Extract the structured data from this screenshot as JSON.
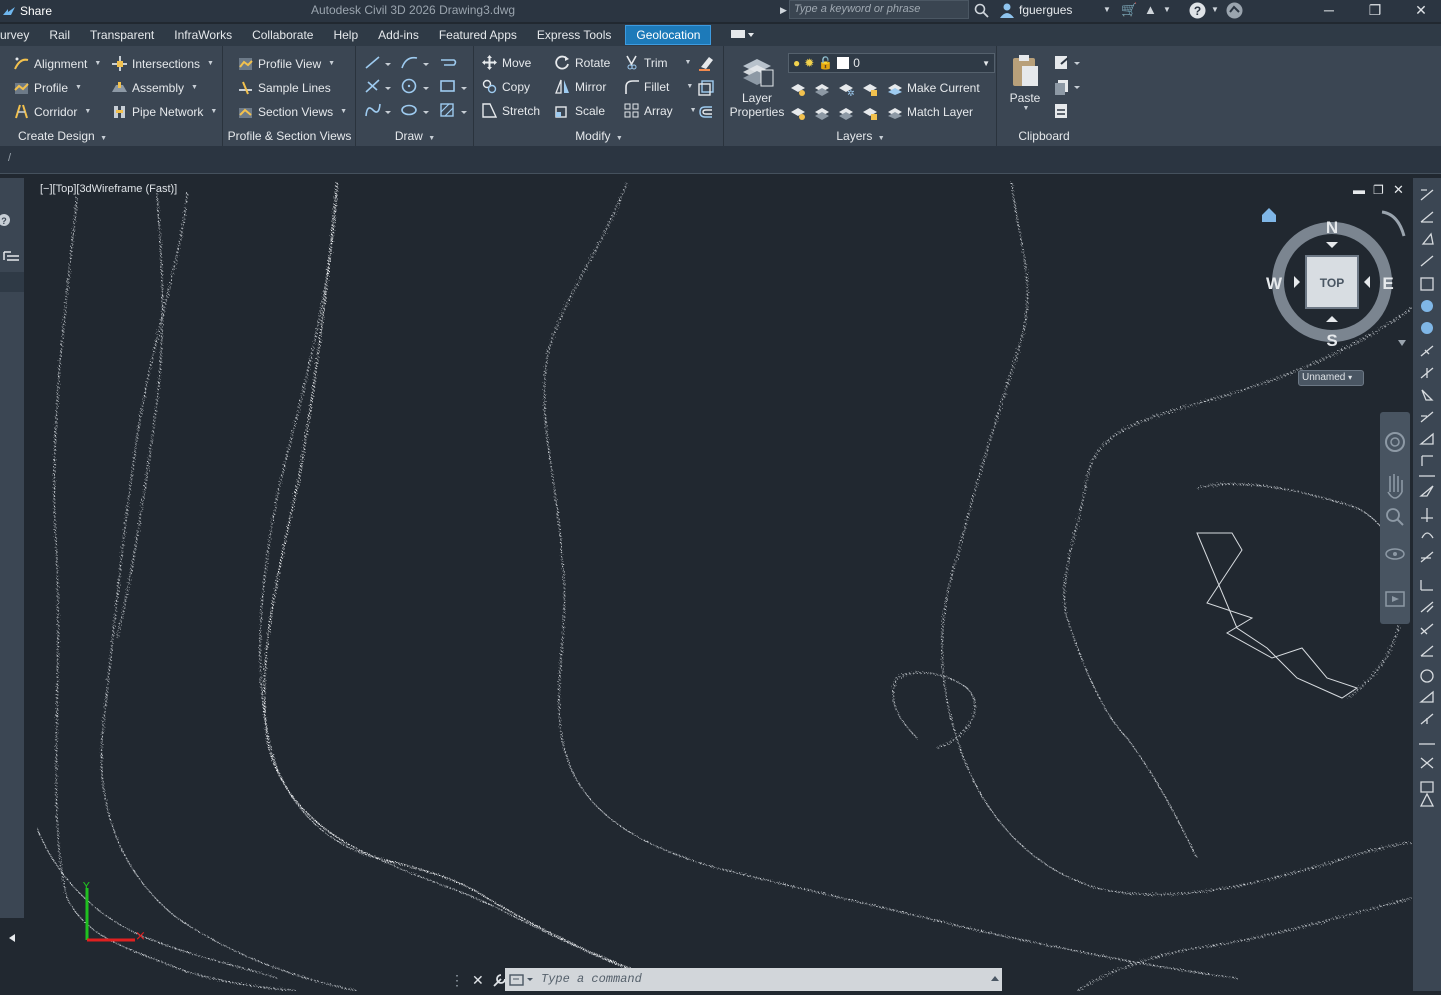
{
  "titlebar": {
    "share_label": "Share",
    "app_title": "Autodesk Civil 3D 2026    Drawing3.dwg",
    "search_placeholder": "Type a keyword or phrase",
    "user": "fguergues"
  },
  "tabs": [
    "urvey",
    "Rail",
    "Transparent",
    "InfraWorks",
    "Collaborate",
    "Help",
    "Add-ins",
    "Featured Apps",
    "Express Tools",
    "Geolocation"
  ],
  "active_tab": "Geolocation",
  "ribbon": {
    "create_design": {
      "title": "Create Design",
      "items": [
        "Alignment",
        "Intersections",
        "Profile",
        "Assembly",
        "Corridor",
        "Pipe Network"
      ]
    },
    "profile_section": {
      "title": "Profile & Section Views",
      "items": [
        "Profile View",
        "Sample Lines",
        "Section Views"
      ]
    },
    "draw": {
      "title": "Draw"
    },
    "modify": {
      "title": "Modify",
      "items": [
        "Move",
        "Rotate",
        "Trim",
        "Copy",
        "Mirror",
        "Fillet",
        "Stretch",
        "Scale",
        "Array"
      ]
    },
    "layers": {
      "title": "Layers",
      "layer_properties": "Layer Properties",
      "current_layer": "0",
      "make_current": "Make Current",
      "match_layer": "Match Layer"
    },
    "clipboard": {
      "title": "Clipboard",
      "paste": "Paste"
    }
  },
  "viewport": {
    "label": "[−][Top][3dWireframe (Fast)]",
    "viewcube": {
      "face": "TOP",
      "north": "N",
      "south": "S",
      "east": "E",
      "west": "W"
    },
    "ucs_name": "Unnamed"
  },
  "command": {
    "placeholder": "Type a command"
  },
  "colors": {
    "accent": "#1d7ab9",
    "canvas": "#212830",
    "ribbon": "#3b4653",
    "axis_x": "#e02020",
    "axis_y": "#20c020"
  }
}
